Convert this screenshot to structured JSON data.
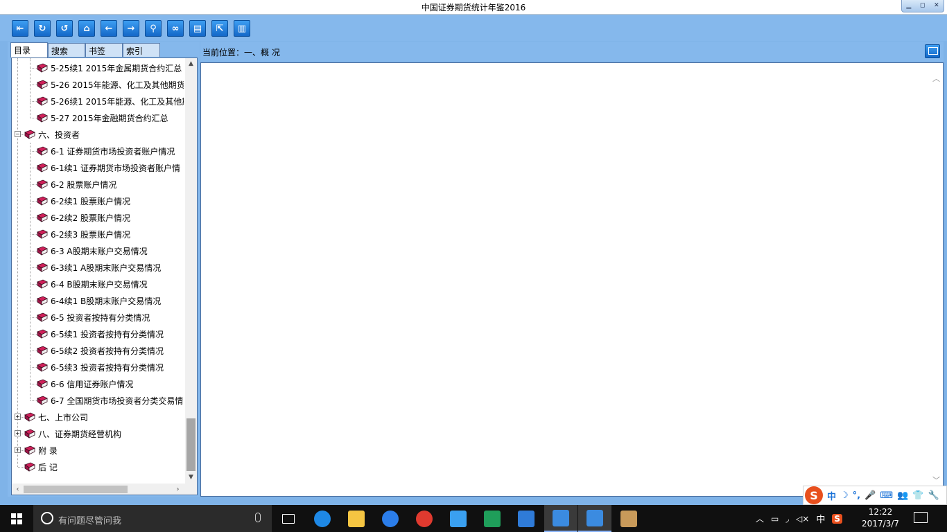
{
  "window": {
    "title": "中国证券期货统计年鉴2016",
    "buttons": [
      "▁",
      "◻",
      "✕"
    ]
  },
  "toolbar": {
    "icons": [
      {
        "name": "exit-icon",
        "glyph": "⇤"
      },
      {
        "name": "refresh-icon",
        "glyph": "↻"
      },
      {
        "name": "undo-icon",
        "glyph": "↺"
      },
      {
        "name": "home-icon",
        "glyph": "⌂"
      },
      {
        "name": "back-icon",
        "glyph": "←"
      },
      {
        "name": "forward-icon",
        "glyph": "→"
      },
      {
        "name": "search-icon",
        "glyph": "⚲"
      },
      {
        "name": "link-icon",
        "glyph": "∞"
      },
      {
        "name": "notes-icon",
        "glyph": "▤"
      },
      {
        "name": "export-icon",
        "glyph": "⇱"
      },
      {
        "name": "document-search-icon",
        "glyph": "▥"
      }
    ]
  },
  "tabs": [
    "目录",
    "搜索",
    "书签",
    "索引"
  ],
  "tree": {
    "items": [
      {
        "label": "5-25续1 2015年金属期货合约汇总",
        "level": 2
      },
      {
        "label": "5-26 2015年能源、化工及其他期货",
        "level": 2
      },
      {
        "label": "5-26续1 2015年能源、化工及其他期",
        "level": 2
      },
      {
        "label": "5-27 2015年金融期货合约汇总",
        "level": 2
      },
      {
        "label": "六、投资者",
        "level": 1,
        "expander": "−"
      },
      {
        "label": "6-1 证券期货市场投资者账户情况",
        "level": 2
      },
      {
        "label": "6-1续1 证券期货市场投资者账户情",
        "level": 2
      },
      {
        "label": "6-2 股票账户情况",
        "level": 2
      },
      {
        "label": "6-2续1 股票账户情况",
        "level": 2
      },
      {
        "label": "6-2续2 股票账户情况",
        "level": 2
      },
      {
        "label": "6-2续3 股票账户情况",
        "level": 2
      },
      {
        "label": "6-3 A股期末账户交易情况",
        "level": 2
      },
      {
        "label": "6-3续1 A股期末账户交易情况",
        "level": 2
      },
      {
        "label": "6-4 B股期末账户交易情况",
        "level": 2
      },
      {
        "label": "6-4续1 B股期末账户交易情况",
        "level": 2
      },
      {
        "label": "6-5 投资者按持有分类情况",
        "level": 2
      },
      {
        "label": "6-5续1 投资者按持有分类情况",
        "level": 2
      },
      {
        "label": "6-5续2 投资者按持有分类情况",
        "level": 2
      },
      {
        "label": "6-5续3 投资者按持有分类情况",
        "level": 2
      },
      {
        "label": "6-6 信用证券账户情况",
        "level": 2
      },
      {
        "label": "6-7 全国期货市场投资者分类交易情",
        "level": 2
      },
      {
        "label": "七、上市公司",
        "level": 1,
        "expander": "+"
      },
      {
        "label": "八、证券期货经营机构",
        "level": 1,
        "expander": "+"
      },
      {
        "label": "附  录",
        "level": 1,
        "expander": "+"
      },
      {
        "label": "后  记",
        "level": 1
      }
    ]
  },
  "location": {
    "text": "当前位置：一、概  况"
  },
  "ime": {
    "logo": "S",
    "items": [
      "中",
      "☽",
      "°,",
      "🎤",
      "⌨",
      "👥",
      "👕",
      "🔧"
    ]
  },
  "taskbar": {
    "search_placeholder": "有问题尽管问我",
    "apps": [
      {
        "name": "task-view-icon",
        "color": "#101010"
      },
      {
        "name": "edge-icon",
        "color": "#1e88e5"
      },
      {
        "name": "file-explorer-icon",
        "color": "#f5c542"
      },
      {
        "name": "sogou-browser-icon",
        "color": "#2b7de9"
      },
      {
        "name": "netease-music-icon",
        "color": "#e03a2f"
      },
      {
        "name": "baidu-netdisk-icon",
        "color": "#3aa0f0"
      },
      {
        "name": "excel-icon",
        "color": "#1f9e5a"
      },
      {
        "name": "window-app-icon",
        "color": "#2f7bd8"
      },
      {
        "name": "yearbook-app-icon",
        "color": "#3b8be0",
        "active": true
      },
      {
        "name": "yearbook-app-2-icon",
        "color": "#3b8be0",
        "active": true
      },
      {
        "name": "paint-icon",
        "color": "#c89a5a"
      }
    ],
    "tray": {
      "ime_label": "中",
      "time": "12:22",
      "date": "2017/3/7"
    }
  }
}
